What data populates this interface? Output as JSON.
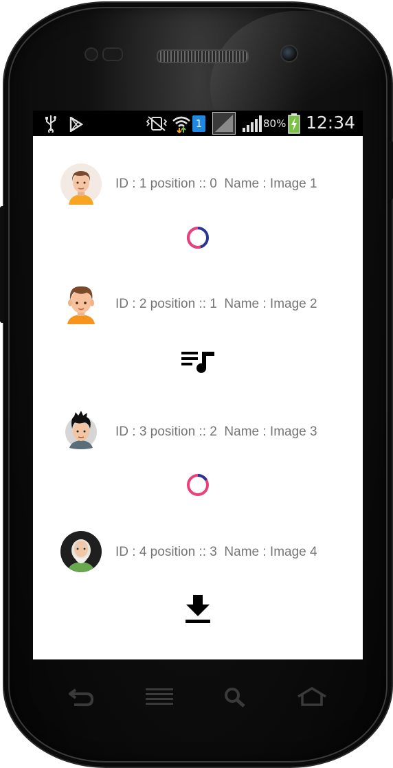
{
  "status_bar": {
    "icons": [
      "usb-icon",
      "play-store-icon",
      "vibrate-mute-icon",
      "wifi-icon",
      "sim-1-icon",
      "data-icon",
      "signal-icon",
      "battery-icon"
    ],
    "sim_label": "1",
    "battery_percent": "80%",
    "time": "12:34"
  },
  "list": {
    "items": [
      {
        "text": "ID : 1 position :: 0  Name : Image 1",
        "avatar": "avatar-young-man-icon",
        "action_icon": "loading-spinner-icon"
      },
      {
        "text": "ID : 2 position :: 1  Name : Image 2",
        "avatar": "avatar-boy-icon",
        "action_icon": "queue-music-icon"
      },
      {
        "text": "ID : 3 position :: 2  Name : Image 3",
        "avatar": "avatar-spiky-hair-man-icon",
        "action_icon": "loading-spinner-icon"
      },
      {
        "text": "ID : 4 position :: 3  Name : Image 4",
        "avatar": "avatar-old-man-icon",
        "action_icon": "download-icon"
      }
    ]
  },
  "nav_bar": {
    "buttons": [
      "back-icon",
      "menu-icon",
      "search-icon",
      "home-icon"
    ]
  },
  "colors": {
    "spinner_pink": "#ec407a",
    "spinner_blue": "#283593",
    "text_gray": "#757575",
    "status_bar_bg": "#000000"
  }
}
